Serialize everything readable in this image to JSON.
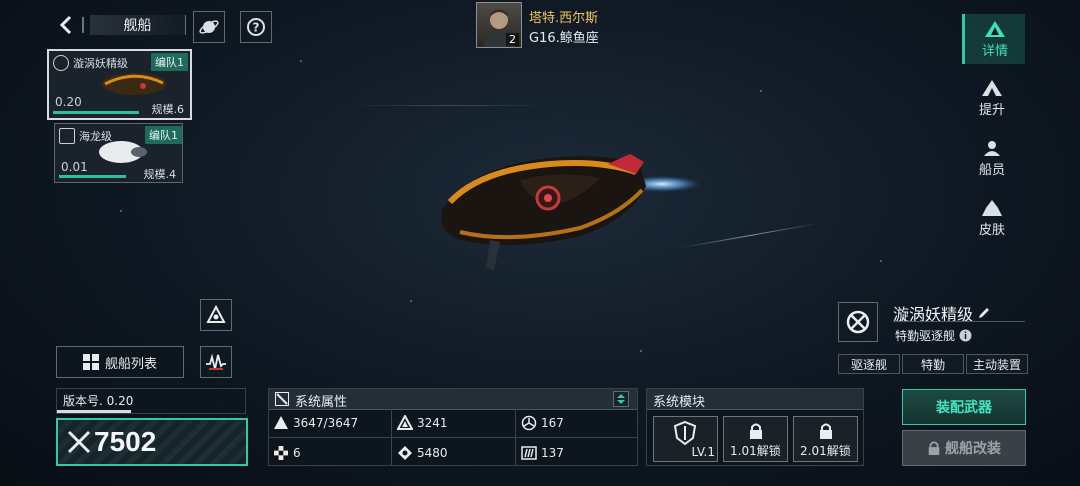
{
  "header": {
    "back_label": "舰船",
    "commander_name": "塔特.西尔斯",
    "commander_level": "2",
    "location": "G16.鲸鱼座"
  },
  "fleet": [
    {
      "name": "漩涡妖精级",
      "tag": "编队1",
      "value": "0.20",
      "scale": "规模.6",
      "progress": 0.65,
      "selected": true
    },
    {
      "name": "海龙级",
      "tag": "编队1",
      "value": "0.01",
      "scale": "规模.4",
      "progress": 0.55,
      "selected": false
    }
  ],
  "side_nav": [
    {
      "label": "详情",
      "icon": "details-icon",
      "active": true
    },
    {
      "label": "提升",
      "icon": "upgrade-icon",
      "active": false
    },
    {
      "label": "船员",
      "icon": "crew-icon",
      "active": false
    },
    {
      "label": "皮肤",
      "icon": "skin-icon",
      "active": false
    }
  ],
  "ship_info": {
    "name": "漩涡妖精级",
    "class": "特勤驱逐舰",
    "tags": [
      "驱逐舰",
      "特勤",
      "主动装置"
    ]
  },
  "ship_list_button": "舰船列表",
  "version": {
    "label": "版本号. 0.20",
    "progress": 0.5
  },
  "power": "7502",
  "attributes": {
    "title": "系统属性",
    "items": [
      {
        "icon": "hull-icon",
        "value": "3647/3647"
      },
      {
        "icon": "armor-icon",
        "value": "3241"
      },
      {
        "icon": "shield-icon",
        "value": "167"
      },
      {
        "icon": "speed-icon",
        "value": "6"
      },
      {
        "icon": "energy-icon",
        "value": "5480"
      },
      {
        "icon": "cargo-icon",
        "value": "137"
      }
    ]
  },
  "modules": {
    "title": "系统模块",
    "slots": [
      {
        "label": "LV.1",
        "icon": "shield-module-icon"
      },
      {
        "label": "1.01解锁",
        "icon": "lock-icon"
      },
      {
        "label": "2.01解锁",
        "icon": "lock-icon"
      }
    ]
  },
  "actions": {
    "equip": "装配武器",
    "modify": "舰船改装"
  },
  "colors": {
    "accent": "#35c8a7",
    "hull_orange": "#d88a1c",
    "engine_glow": "#7fbaf0"
  }
}
